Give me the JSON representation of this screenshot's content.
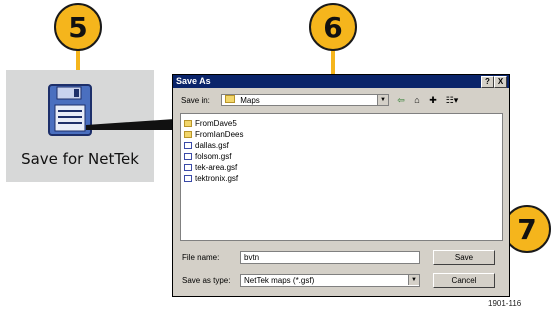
{
  "callouts": [
    "5",
    "6",
    "7"
  ],
  "save_panel": {
    "label": "Save for NetTek",
    "icon": "floppy-disk-icon"
  },
  "dialog": {
    "title": "Save As",
    "help_button": "?",
    "close_button": "X",
    "save_in_label": "Save in:",
    "save_in_value": "Maps",
    "files": [
      {
        "name": "FromDave5",
        "kind": "folder"
      },
      {
        "name": "FromIanDees",
        "kind": "folder"
      },
      {
        "name": "dallas.gsf",
        "kind": "file"
      },
      {
        "name": "folsom.gsf",
        "kind": "file"
      },
      {
        "name": "tek-area.gsf",
        "kind": "file"
      },
      {
        "name": "tektronix.gsf",
        "kind": "file"
      }
    ],
    "file_name_label": "File name:",
    "file_name_value": "bvtn",
    "save_as_type_label": "Save as type:",
    "save_as_type_value": "NetTek maps (*.gsf)",
    "save_button": "Save",
    "cancel_button": "Cancel"
  },
  "figure_id": "1901-116",
  "colors": {
    "callout": "#f5b51c",
    "titlebar": "#0a246a",
    "dialog": "#d4d0c8"
  }
}
